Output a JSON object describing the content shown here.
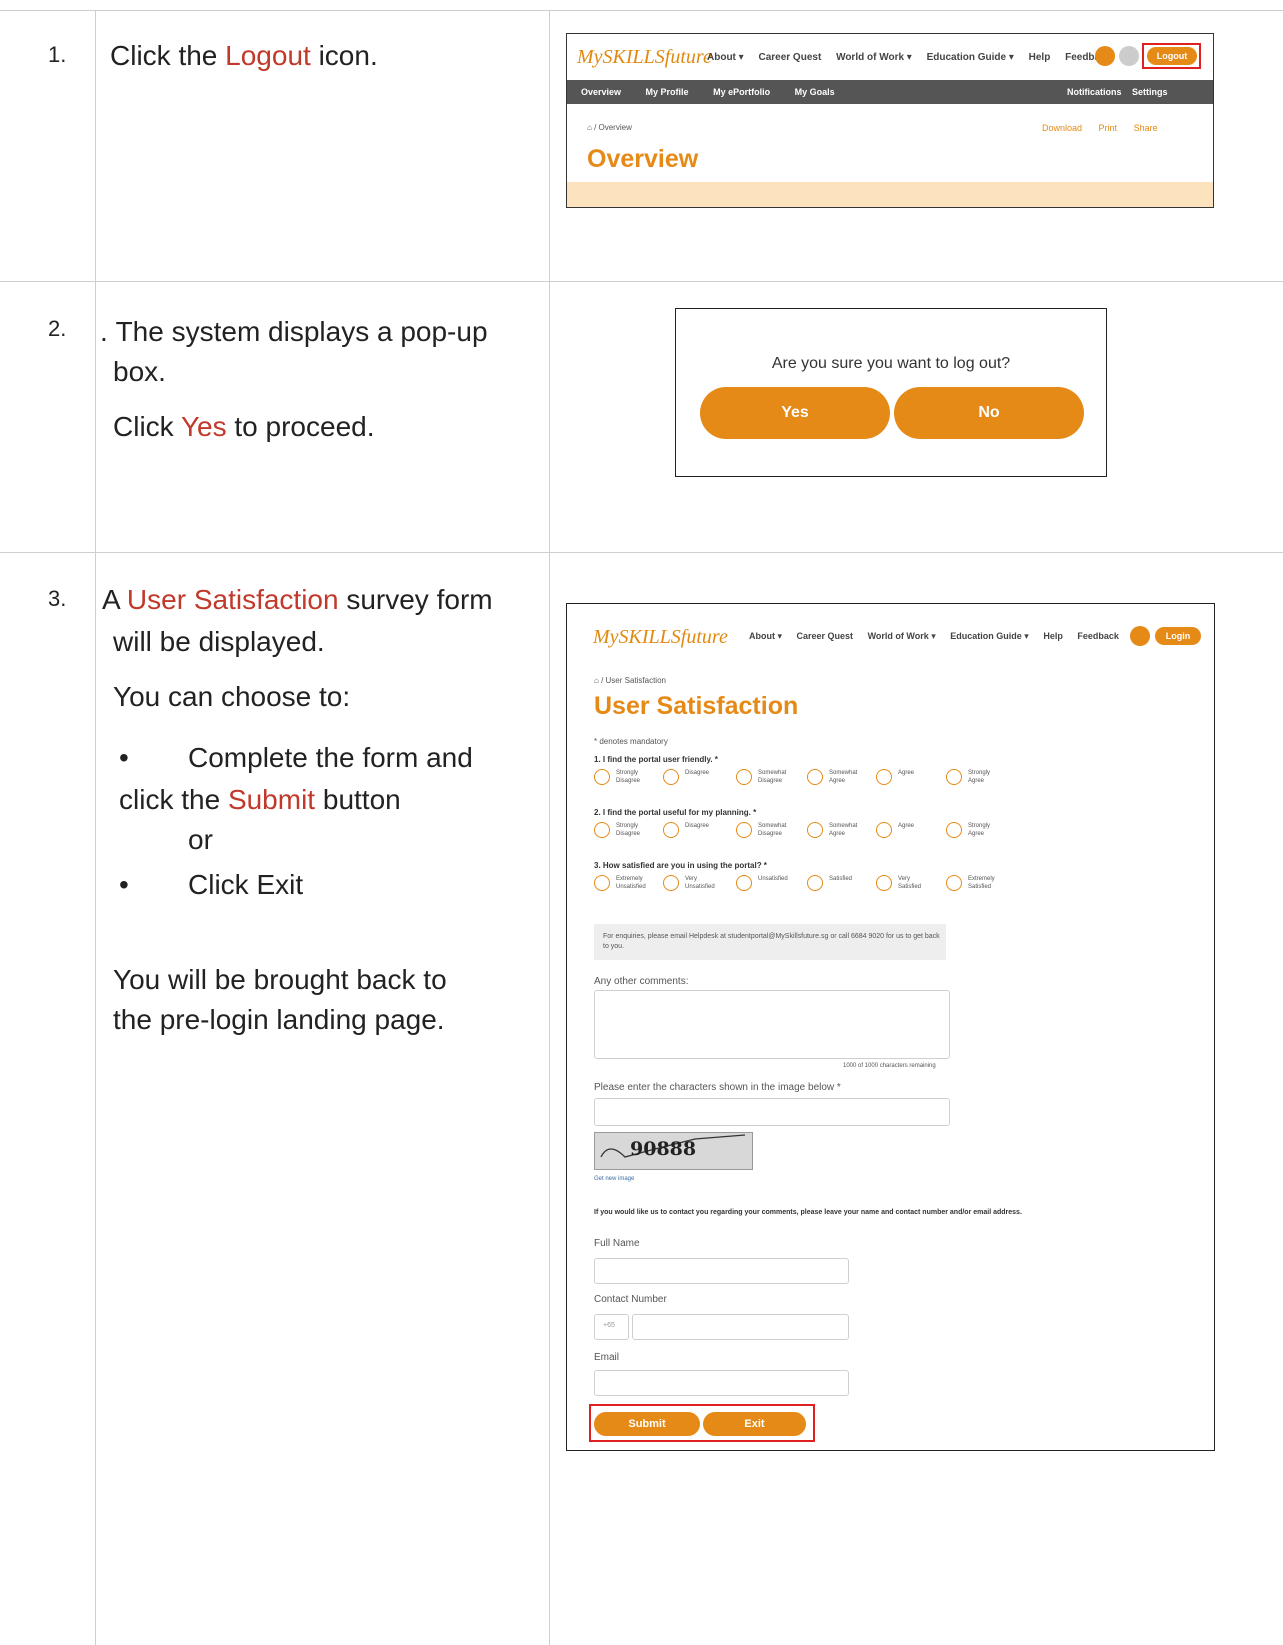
{
  "steps": [
    {
      "number": "1.",
      "lines": [
        [
          "Click the ",
          "Logout",
          " icon."
        ]
      ]
    },
    {
      "number": "2.",
      "lines": [
        [
          "The system displays a pop-up"
        ],
        [
          "box."
        ],
        [
          "Click ",
          "Yes",
          " to proceed."
        ]
      ]
    },
    {
      "number": "3.",
      "lines": [
        [
          "A ",
          "User Satisfaction",
          " survey form"
        ],
        [
          "will be displayed."
        ],
        [
          "You can choose to:"
        ]
      ],
      "bullet1": [
        "Complete the form and",
        "click the ",
        "Submit",
        " button"
      ],
      "or": "or",
      "bullet2": "Click Exit",
      "closing": [
        "You will be brought back to",
        "the pre-login landing page."
      ]
    }
  ],
  "bullet_char": "•",
  "shot1": {
    "brand_my": "My",
    "brand_skills": "SKILLS",
    "brand_future": "future",
    "nav": [
      "About ▾",
      "Career Quest",
      "World of Work ▾",
      "Education Guide ▾",
      "Help",
      "Feedback"
    ],
    "logout": "Logout",
    "subnav": [
      "Overview",
      "My Profile",
      "My ePortfolio",
      "My Goals"
    ],
    "notifications": "Notifications",
    "settings": "Settings",
    "breadcrumb": "/ Overview",
    "actions": [
      "Download",
      "Print",
      "Share"
    ],
    "title": "Overview"
  },
  "shot2": {
    "question": "Are you sure you want to log out?",
    "yes": "Yes",
    "no": "No"
  },
  "shot3": {
    "brand_my": "My",
    "brand_skills": "SKILLS",
    "brand_future": "future",
    "nav": [
      "About ▾",
      "Career Quest",
      "World of Work ▾",
      "Education Guide ▾",
      "Help",
      "Feedback"
    ],
    "login": "Login",
    "breadcrumb": "/ User Satisfaction",
    "title": "User Satisfaction",
    "mandatory": "* denotes mandatory",
    "questions": [
      {
        "q": "1. I find the portal user friendly. *",
        "options": [
          "Strongly\nDisagree",
          "Disagree",
          "Somewhat\nDisagree",
          "Somewhat\nAgree",
          "Agree",
          "Strongly\nAgree"
        ]
      },
      {
        "q": "2. I find the portal useful for my planning. *",
        "options": [
          "Strongly\nDisagree",
          "Disagree",
          "Somewhat\nDisagree",
          "Somewhat\nAgree",
          "Agree",
          "Strongly\nAgree"
        ]
      },
      {
        "q": "3. How satisfied are you in using the portal? *",
        "options": [
          "Extremely\nUnsatisfied",
          "Very\nUnsatisfied",
          "Unsatisfied",
          "Satisfied",
          "Very\nSatisfied",
          "Extremely\nSatisfied"
        ]
      }
    ],
    "enquiry": "For enquiries, please email Helpdesk at studentportal@MySkillsfuture.sg or call 6684 9020 for us to get back to you.",
    "comments_label": "Any other comments:",
    "chars_remaining": "1000 of 1000 characters remaining",
    "captcha_label": "Please enter the characters shown in the image below *",
    "captcha_text": "90888",
    "new_image": "Get new image",
    "contact_note": "If you would like us to contact you regarding your comments, please leave your name and contact number and/or email address.",
    "full_name": "Full Name",
    "contact_number": "Contact Number",
    "country_code": "+65",
    "email": "Email",
    "submit": "Submit",
    "exit": "Exit"
  }
}
